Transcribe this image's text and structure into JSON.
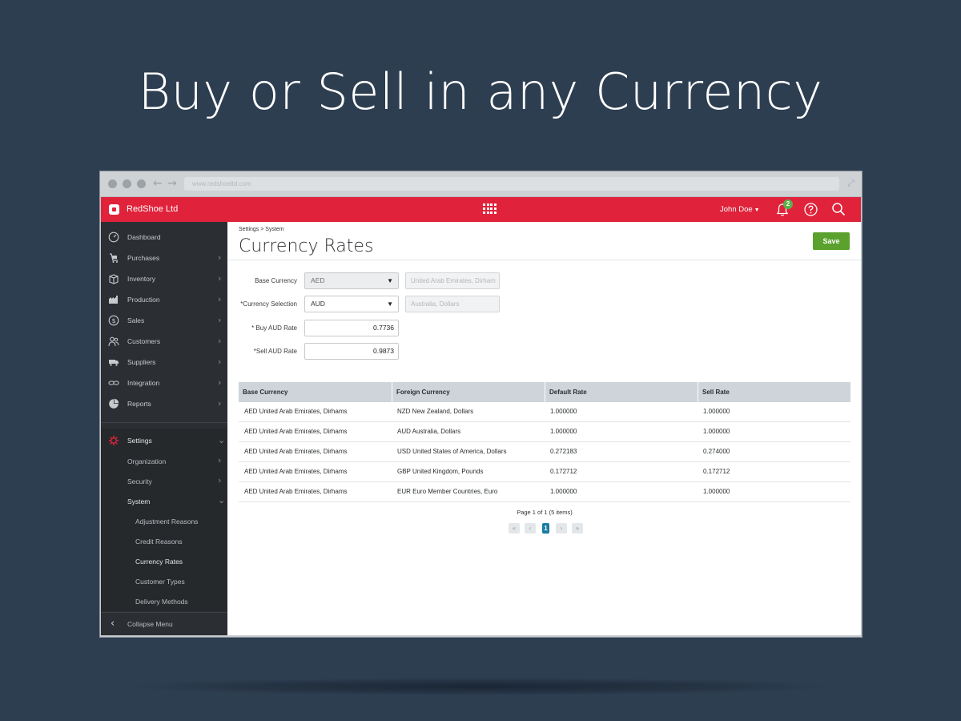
{
  "headline": "Buy or Sell in any Currency",
  "browser": {
    "url": "www.redshoeltd.com"
  },
  "topbar": {
    "brand": "RedShoe Ltd",
    "user": "John Doe",
    "notification_count": "2",
    "accent_color": "#e0233b"
  },
  "sidebar": {
    "items": [
      {
        "label": "Dashboard",
        "icon": "dashboard-icon"
      },
      {
        "label": "Purchases",
        "icon": "cart-icon"
      },
      {
        "label": "Inventory",
        "icon": "box-icon"
      },
      {
        "label": "Production",
        "icon": "factory-icon"
      },
      {
        "label": "Sales",
        "icon": "dollar-icon"
      },
      {
        "label": "Customers",
        "icon": "customers-icon"
      },
      {
        "label": "Suppliers",
        "icon": "truck-icon"
      },
      {
        "label": "Integration",
        "icon": "link-icon"
      },
      {
        "label": "Reports",
        "icon": "pie-chart-icon"
      }
    ],
    "settings": {
      "label": "Settings",
      "organization": "Organization",
      "security": "Security",
      "system": "System",
      "system_items": [
        "Adjustment Reasons",
        "Credit Reasons",
        "Currency Rates",
        "Customer Types",
        "Delivery Methods"
      ]
    },
    "collapse_label": "Collapse Menu"
  },
  "main": {
    "breadcrumb": "Settings > System",
    "title": "Currency Rates",
    "save_label": "Save",
    "form": {
      "base_currency_label": "Base Currency",
      "base_currency_value": "AED",
      "base_currency_name": "United Arab Emirates, Dirham",
      "currency_selection_label": "*Currency Selection",
      "currency_selection_value": "AUD",
      "currency_selection_name": "Australia, Dollars",
      "buy_rate_label": "* Buy AUD Rate",
      "buy_rate_value": "0.7736",
      "sell_rate_label": "*Sell AUD Rate",
      "sell_rate_value": "0.9873"
    },
    "table": {
      "headers": [
        "Base Currency",
        "Foreign Currency",
        "Default Rate",
        "Sell Rate"
      ],
      "rows": [
        [
          "AED United Arab Emirates, Dirhams",
          "NZD New Zealand, Dollars",
          "1.000000",
          "1.000000"
        ],
        [
          "AED United Arab Emirates, Dirhams",
          "AUD Australia, Dollars",
          "1.000000",
          "1.000000"
        ],
        [
          "AED United Arab Emirates, Dirhams",
          "USD United States of America, Dollars",
          "0.272183",
          "0.274000"
        ],
        [
          "AED United Arab Emirates, Dirhams",
          "GBP United Kingdom, Pounds",
          "0.172712",
          "0.172712"
        ],
        [
          "AED United Arab Emirates, Dirhams",
          "EUR Euro Member Countries, Euro",
          "1.000000",
          "1.000000"
        ]
      ]
    },
    "pagination": {
      "text": "Page 1 of 1 (5 items)",
      "current_page": "1"
    }
  }
}
